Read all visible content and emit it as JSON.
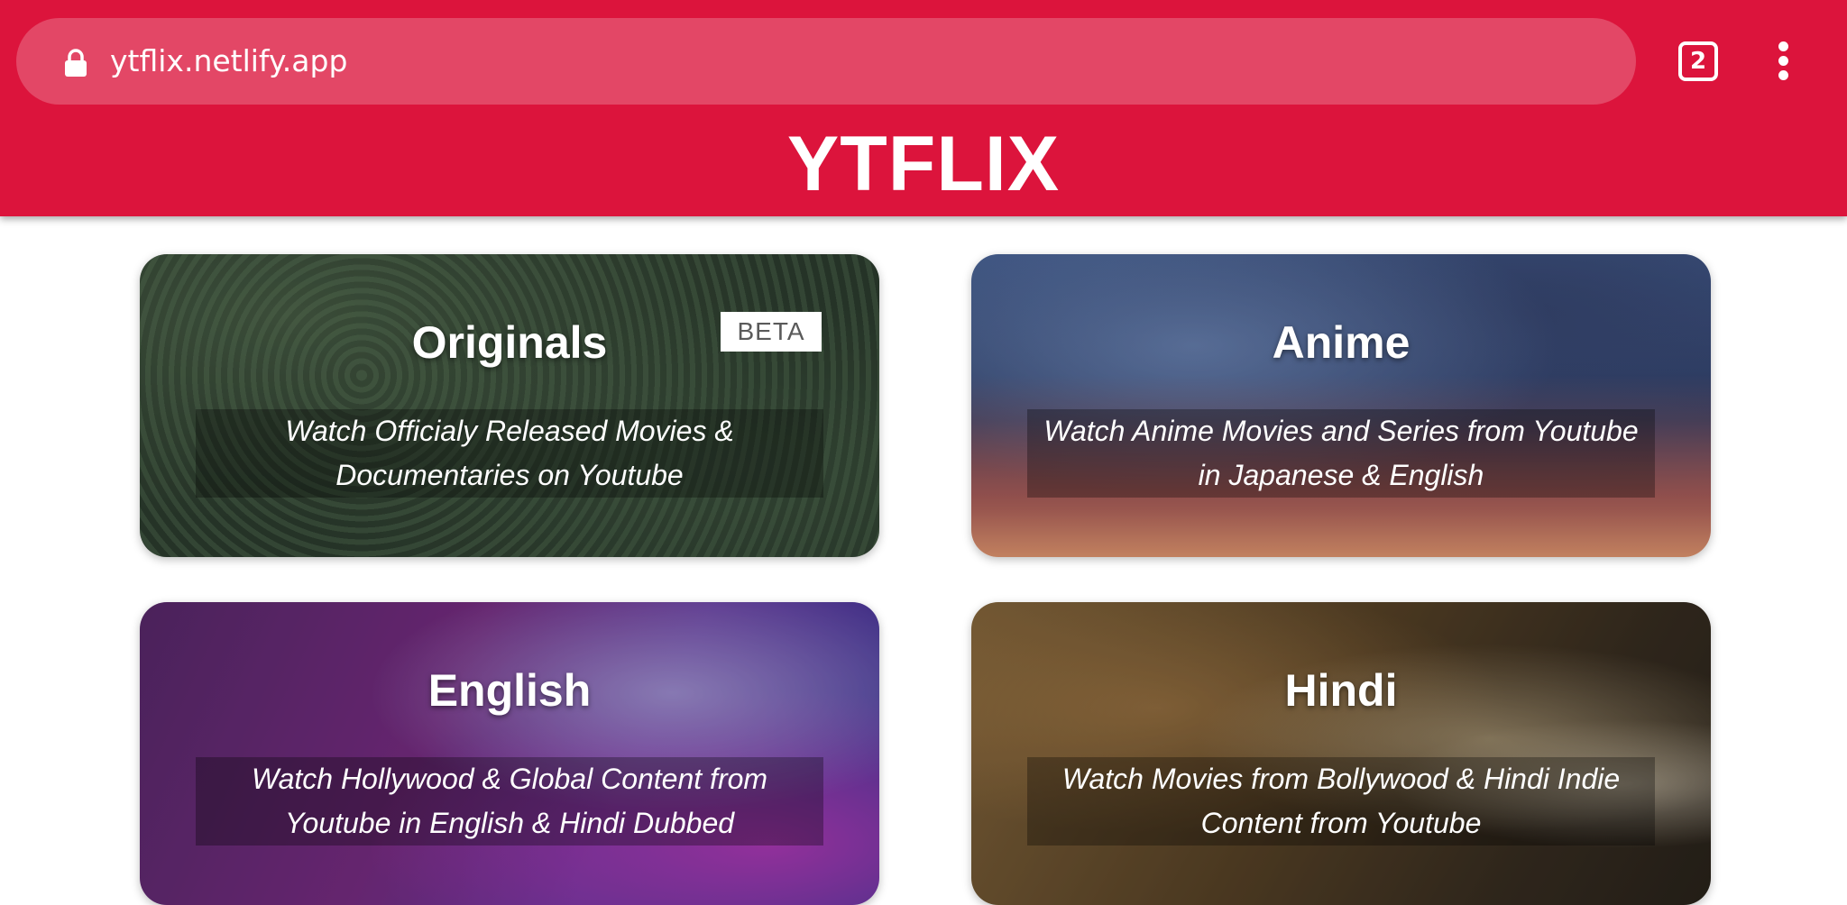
{
  "browser": {
    "url": "ytflix.netlify.app",
    "tab_count": "2"
  },
  "header": {
    "brand": "YTFLIX",
    "background_color": "#dc143c"
  },
  "cards": [
    {
      "title": "Originals",
      "badge": "BETA",
      "description": "Watch Officialy Released Movies & Documentaries on Youtube"
    },
    {
      "title": "Anime",
      "description": "Watch Anime Movies and Series from Youtube in Japanese & English"
    },
    {
      "title": "English",
      "description": "Watch Hollywood & Global Content from Youtube in English & Hindi Dubbed"
    },
    {
      "title": "Hindi",
      "description": "Watch Movies from Bollywood & Hindi Indie Content from Youtube"
    }
  ]
}
